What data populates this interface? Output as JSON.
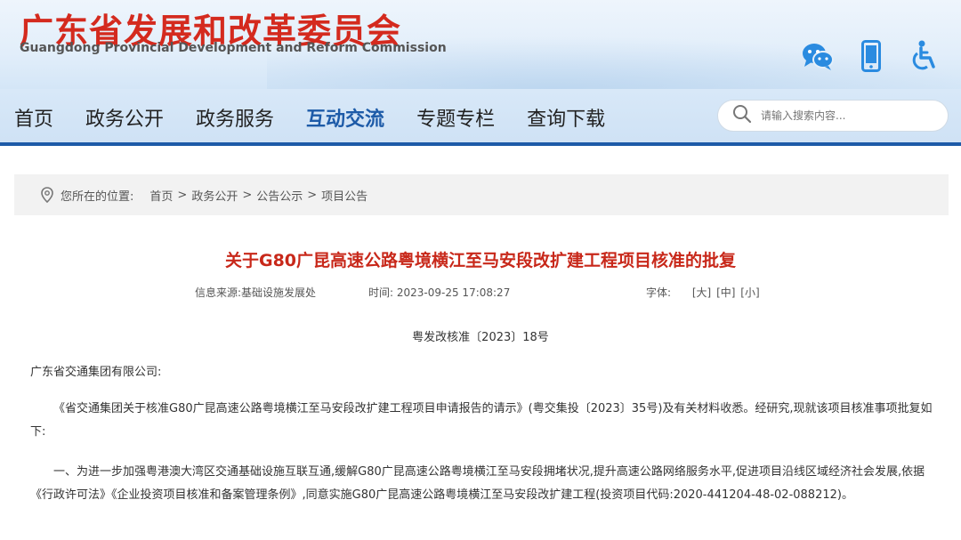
{
  "header": {
    "title": "广东省发展和改革委员会",
    "subtitle": "Guangdong Provincial Development and Reform Commission",
    "icons": [
      "wechat-icon",
      "mobile-icon",
      "accessibility-icon"
    ]
  },
  "nav": {
    "items": [
      "首页",
      "政务公开",
      "政务服务",
      "互动交流",
      "专题专栏",
      "查询下载"
    ],
    "active": "互动交流",
    "search_placeholder": "请输入搜索内容..."
  },
  "breadcrumb": {
    "label": "您所在的位置:",
    "items": [
      "首页",
      "政务公开",
      "公告公示",
      "项目公告"
    ],
    "separator": ">"
  },
  "article": {
    "title": "关于G80广昆高速公路粤境横江至马安段改扩建工程项目核准的批复",
    "source_label": "信息来源:",
    "source": "基础设施发展处",
    "time_label": "时间:",
    "time": "2023-09-25 17:08:27",
    "font_label": "字体:",
    "font_sizes": [
      "[大]",
      "[中]",
      "[小]"
    ],
    "doc_number": "粤发改核准〔2023〕18号",
    "addressee": "广东省交通集团有限公司:",
    "paragraph1": "《省交通集团关于核准G80广昆高速公路粤境横江至马安段改扩建工程项目申请报告的请示》(粤交集投〔2023〕35号)及有关材料收悉。经研究,现就该项目核准事项批复如下:",
    "paragraph2": "一、为进一步加强粤港澳大湾区交通基础设施互联互通,缓解G80广昆高速公路粤境横江至马安段拥堵状况,提升高速公路网络服务水平,促进项目沿线区域经济社会发展,依据《行政许可法》《企业投资项目核准和备案管理条例》,同意实施G80广昆高速公路粤境横江至马安段改扩建工程(投资项目代码:2020-441204-48-02-088212)。"
  },
  "colors": {
    "title_red": "#d42a1e",
    "nav_blue": "#1d5ba8",
    "article_title_red": "#c8281a"
  }
}
